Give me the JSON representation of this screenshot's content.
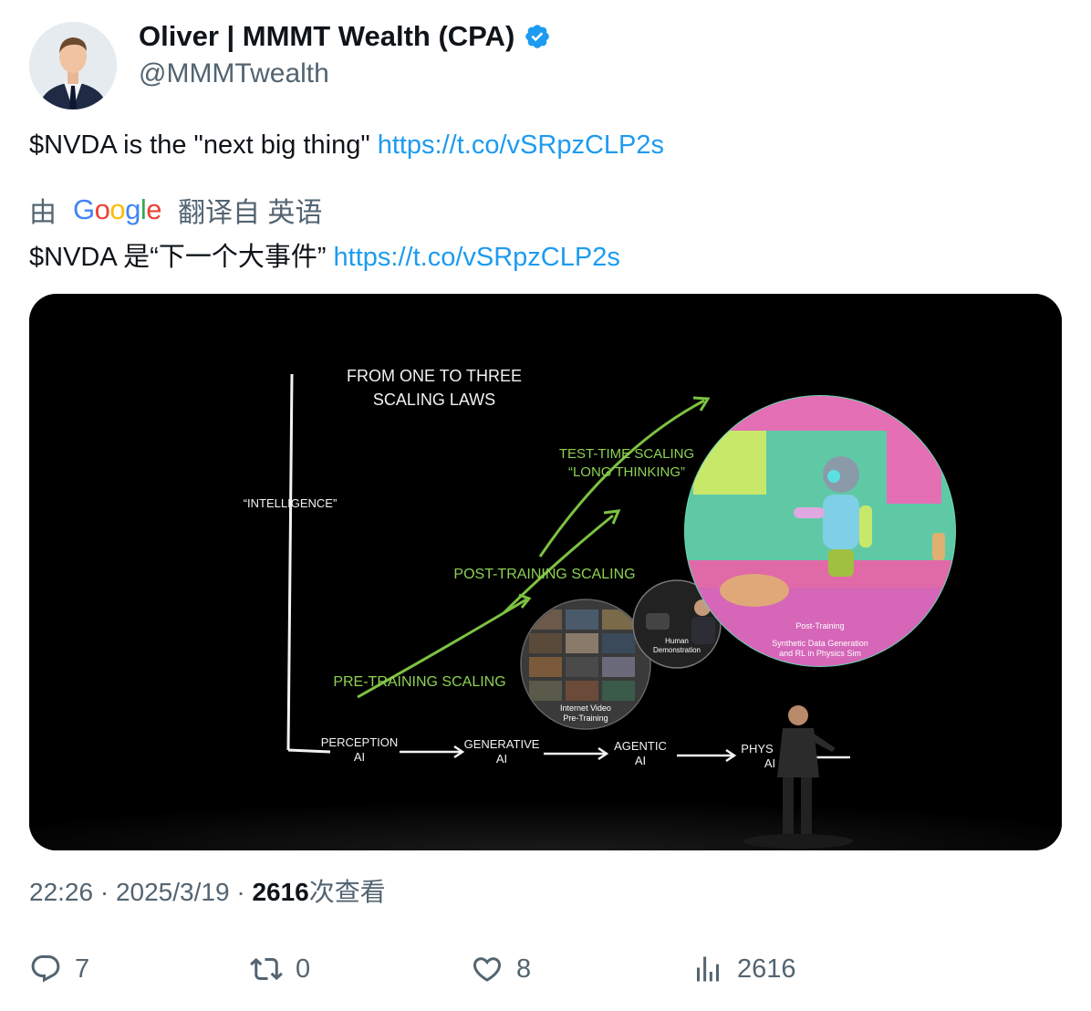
{
  "author": {
    "display_name": "Oliver | MMMT Wealth (CPA)",
    "handle": "@MMMTwealth"
  },
  "tweet": {
    "text": "$NVDA is the \"next big thing\" ",
    "link": "https://t.co/vSRpzCLP2s"
  },
  "translation": {
    "prefix": "由",
    "provider": "Google",
    "suffix": "翻译自 英语",
    "text": "$NVDA 是“下一个大事件” ",
    "link": "https://t.co/vSRpzCLP2s"
  },
  "media": {
    "title_line1": "FROM ONE TO THREE",
    "title_line2": "SCALING LAWS",
    "y_label": "“INTELLIGENCE”",
    "pre_training": "PRE-TRAINING SCALING",
    "post_training": "POST-TRAINING SCALING",
    "test_time_line1": "TEST-TIME SCALING",
    "test_time_line2": "“LONG THINKING”",
    "stage1_line1": "PERCEPTION",
    "stage1_line2": "AI",
    "stage2_line1": "GENERATIVE",
    "stage2_line2": "AI",
    "stage3_line1": "AGENTIC",
    "stage3_line2": "AI",
    "stage4_line1": "PHYS",
    "stage4_line2": "AI",
    "circle_small_line1": "Internet Video",
    "circle_small_line2": "Pre-Training",
    "circle_mid_line1": "Human",
    "circle_mid_line2": "Demonstration",
    "circle_big_title": "Post-Training",
    "circle_big_line1": "Synthetic Data Generation",
    "circle_big_line2": "and RL in Physics Sim"
  },
  "meta": {
    "time": "22:26",
    "sep1": " · ",
    "date": "2025/3/19",
    "sep2": " · ",
    "views": "2616",
    "views_label": "次查看"
  },
  "actions": {
    "replies": "7",
    "retweets": "0",
    "likes": "8",
    "views": "2616"
  },
  "colors": {
    "link": "#1d9bf0",
    "verified": "#1d9bf0",
    "arrow_green": "#7dc242"
  }
}
